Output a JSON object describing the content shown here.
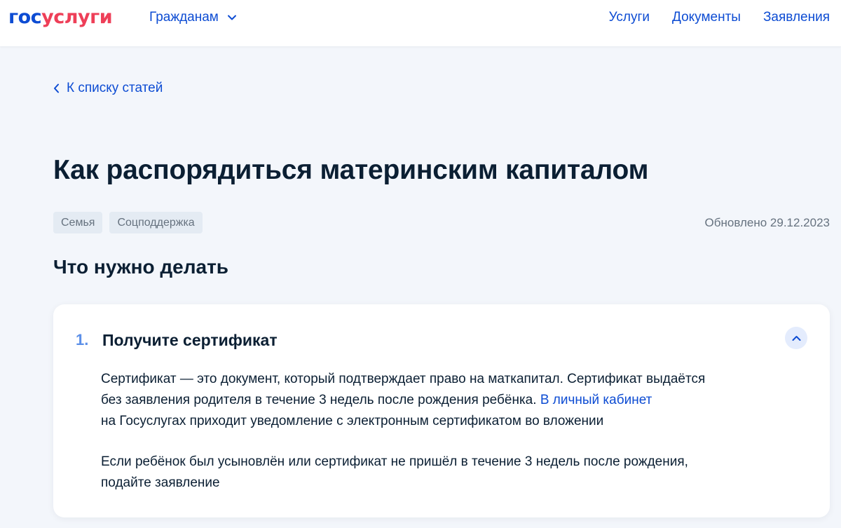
{
  "header": {
    "logo_part1": "гос",
    "logo_part2": "услуги",
    "audience_menu_label": "Гражданам",
    "nav": [
      "Услуги",
      "Документы",
      "Заявления"
    ]
  },
  "back_link": "К списку статей",
  "article": {
    "title": "Как распорядиться материнским капиталом",
    "tags": [
      "Семья",
      "Соцподдержка"
    ],
    "updated": "Обновлено 29.12.2023",
    "section_title": "Что нужно делать"
  },
  "step": {
    "number": "1.",
    "title": "Получите сертификат",
    "para1_line1": "Сертификат — это документ, который подтверждает право на маткапитал. Сертификат выдаётся",
    "para1_line2_start": "без заявления родителя в течение 3 недель после рождения ребёнка. ",
    "para1_link": "В личный кабинет",
    "para1_line3": "на Госуслугах приходит уведомление с электронным сертификатом во вложении",
    "para2_line1": "Если ребёнок был усыновлён или сертификат не пришёл в течение 3 недель после рождения,",
    "para2_line2": "подайте заявление"
  },
  "colors": {
    "brand_blue": "#0d4cd3",
    "brand_red": "#ee3f58",
    "page_bg": "#f3f6fb",
    "text_primary": "#0b1f33",
    "text_secondary": "#66727f",
    "step_number": "#5b8fe8"
  },
  "icons": {
    "audience_menu": "chevron-down-icon",
    "back_link": "chevron-left-icon",
    "collapse": "chevron-up-icon"
  }
}
